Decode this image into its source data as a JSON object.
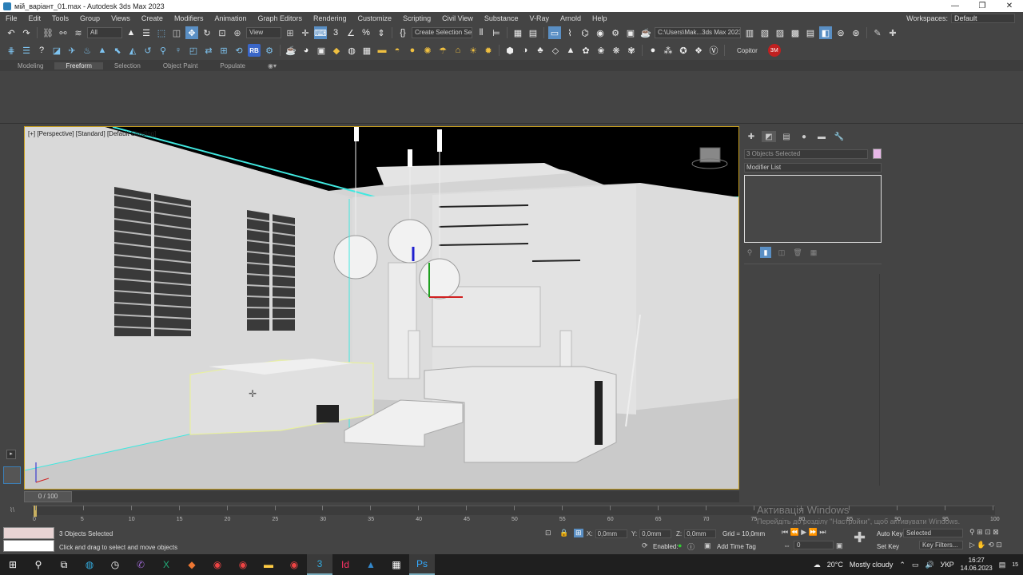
{
  "window": {
    "title": "мій_варіант_01.max - Autodesk 3ds Max 2023",
    "min_label": "—",
    "max_label": "❐",
    "close_label": "✕"
  },
  "menu": {
    "items": [
      "File",
      "Edit",
      "Tools",
      "Group",
      "Views",
      "Create",
      "Modifiers",
      "Animation",
      "Graph Editors",
      "Rendering",
      "Customize",
      "Scripting",
      "Civil View",
      "Substance",
      "V-Ray",
      "Arnold",
      "Help"
    ],
    "workspaces_label": "Workspaces:",
    "workspaces_value": "Default"
  },
  "toolbar1": {
    "filter_value": "All",
    "view_value": "View",
    "create_selection_value": "Create Selection Se",
    "project_path": "C:\\Users\\Mak...3ds Max 2023"
  },
  "toolbar2": {
    "copitor_label": "Copitor",
    "rb_label": "RB"
  },
  "ribbon": {
    "tabs": [
      "Modeling",
      "Freeform",
      "Selection",
      "Object Paint",
      "Populate"
    ],
    "active": "Freeform"
  },
  "viewport": {
    "label": "[+] [Perspective] [Standard] [Default Shading]"
  },
  "command_panel": {
    "selection_name": "3 Objects Selected",
    "modifier_list": "Modifier List",
    "object_color": "#e8b8e8"
  },
  "time_slider": {
    "value": "0 / 100"
  },
  "timeline": {
    "ticks": [
      "0",
      "5",
      "10",
      "15",
      "20",
      "25",
      "30",
      "35",
      "40",
      "45",
      "50",
      "55",
      "60",
      "65",
      "70",
      "75",
      "80",
      "85",
      "90",
      "95",
      "100"
    ]
  },
  "status": {
    "selected_text": "3 Objects Selected",
    "prompt_text": "Click and drag to select and move objects",
    "x_label": "X:",
    "x_value": "0,0mm",
    "y_label": "Y:",
    "y_value": "0,0mm",
    "z_label": "Z:",
    "z_value": "0,0mm",
    "grid_text": "Grid = 10,0mm",
    "enabled_label": "Enabled:",
    "add_time_tag": "Add Time Tag",
    "auto_key": "Auto Key",
    "selected_dd": "Selected",
    "set_key": "Set Key",
    "key_filters": "Key Filters...",
    "frame_value": "0"
  },
  "watermark": {
    "line1": "Активація Windows",
    "line2": "Перейдіть до розділу \"Настройки\", щоб активувати Windows."
  },
  "taskbar": {
    "weather_temp": "20°C",
    "weather_text": "Mostly cloudy",
    "lang": "УКР",
    "time": "16:27",
    "date": "14.06.2023",
    "notif_count": "15"
  },
  "colors": {
    "selection_box": "#e8f0a0",
    "wire_cyan": "#40e8e0",
    "viewport_border": "#c8a020"
  }
}
